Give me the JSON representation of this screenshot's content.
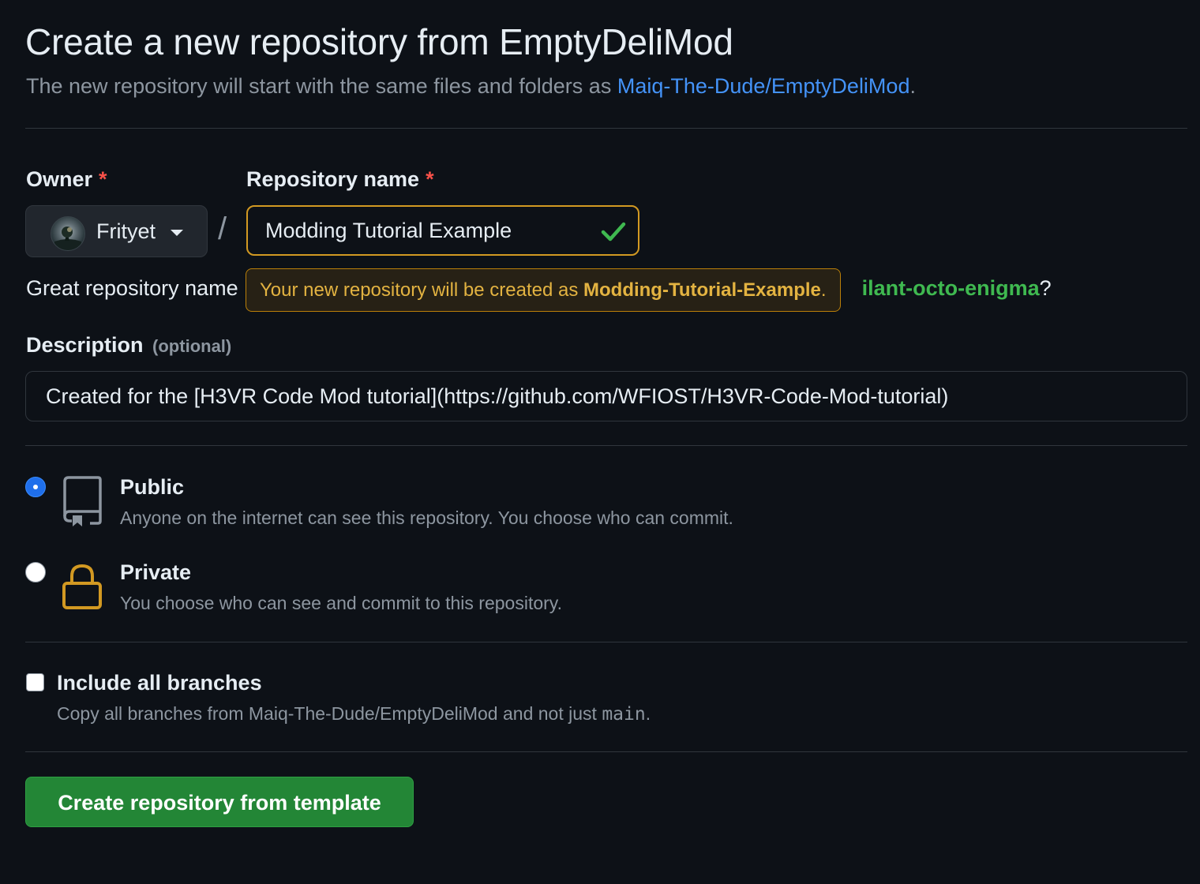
{
  "page": {
    "title": "Create a new repository from EmptyDeliMod",
    "subtitle_prefix": "The new repository will start with the same files and folders as ",
    "subtitle_link": "Maiq-The-Dude/EmptyDeliMod",
    "subtitle_suffix": "."
  },
  "owner": {
    "label": "Owner",
    "required_mark": "*",
    "selected": "Frityet"
  },
  "repo_name": {
    "label": "Repository name",
    "required_mark": "*",
    "value": "Modding Tutorial Example",
    "separator": "/"
  },
  "availability": {
    "prefix": "Great repository name",
    "suggestion": "ilant-octo-enigma",
    "suffix": "?"
  },
  "tooltip": {
    "prefix": "Your new repository will be created as ",
    "name": "Modding-Tutorial-Example",
    "suffix": "."
  },
  "description": {
    "label": "Description",
    "optional": "(optional)",
    "value": "Created for the [H3VR Code Mod tutorial](https://github.com/WFIOST/H3VR-Code-Mod-tutorial)"
  },
  "visibility": {
    "selected": "public",
    "options": [
      {
        "title": "Public",
        "description": "Anyone on the internet can see this repository. You choose who can commit."
      },
      {
        "title": "Private",
        "description": "You choose who can see and commit to this repository."
      }
    ]
  },
  "branches": {
    "checked": false,
    "label": "Include all branches",
    "desc_prefix": "Copy all branches from Maiq-The-Dude/EmptyDeliMod and not just ",
    "desc_code": "main",
    "desc_suffix": "."
  },
  "submit": {
    "label": "Create repository from template"
  },
  "colors": {
    "background": "#0d1117",
    "link": "#4493f8",
    "success": "#3fb950",
    "warning": "#d29922",
    "primary_button": "#238636",
    "lock_icon": "#d29922"
  },
  "icons": {
    "owner_caret": "chevron-down-icon",
    "repo_valid": "check-icon",
    "public": "repo-icon",
    "private": "lock-icon"
  }
}
